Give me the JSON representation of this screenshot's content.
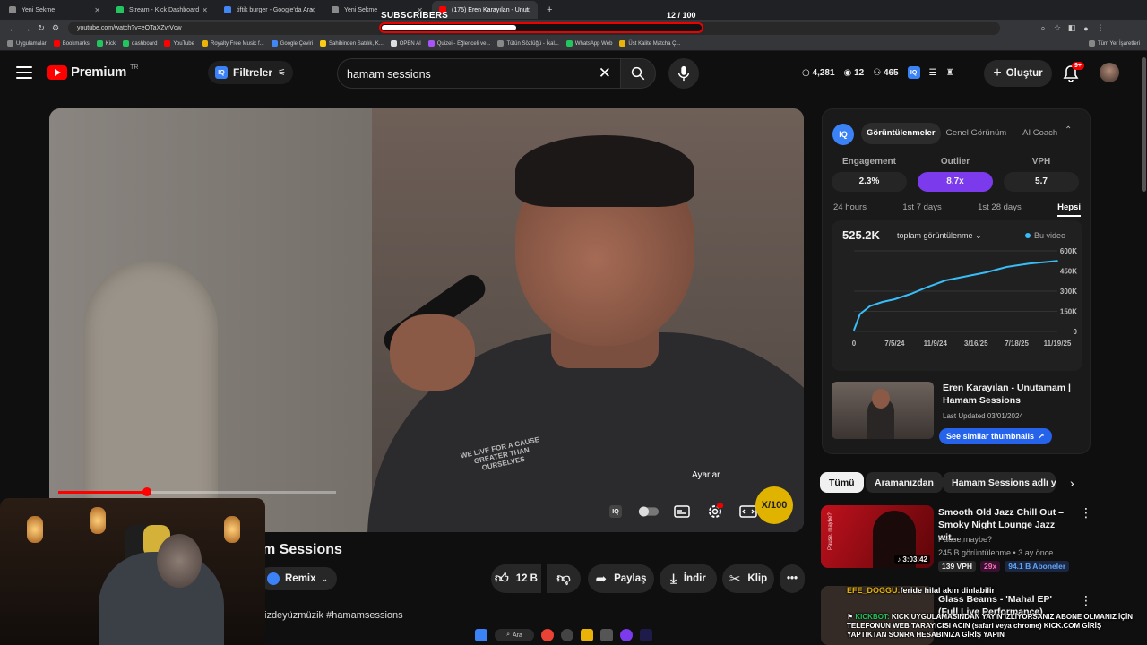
{
  "browser": {
    "tabs": [
      {
        "label": "Yeni Sekme",
        "color": "#8a8a8a"
      },
      {
        "label": "Stream - Kick Dashboard",
        "color": "#22c55e"
      },
      {
        "label": "tiftik burger - Google'da Ara",
        "color": "#4285f4"
      },
      {
        "label": "Yeni Sekme",
        "color": "#8a8a8a"
      },
      {
        "label": "(175) Eren Karayılan - Unut",
        "color": "#ff0000"
      }
    ],
    "url": "youtube.com/watch?v=eOTaXZvrVcw",
    "bookmarks": [
      "Uygulamalar",
      "Bookmarks",
      "Kick",
      "dashboard",
      "YouTube",
      "Royalty Free Music f...",
      "Google Çeviri",
      "Sahibinden Satılık, K...",
      "OPEN AI",
      "Quizei - Eğlenceli ve...",
      "Tütün Sözlüğü - İkal...",
      "WhatsApp Web",
      "Üst Kalite Matcha Ç..."
    ],
    "all_bookmarks": "Tüm Yer İşaretleri"
  },
  "subscribers": {
    "label": "SUBSCRIBERS",
    "count_text": "12  / 100",
    "current": 12,
    "goal": 100
  },
  "header": {
    "logo_text": "Premium",
    "logo_region": "TR",
    "filters_label": "Filtreler",
    "search_value": "hamam sessions",
    "stats": [
      "4,281",
      "12",
      "465"
    ],
    "create_label": "Oluştur",
    "notifications": "9+"
  },
  "video": {
    "progress_fraction": 0.32,
    "tooltip": "Ayarlar",
    "shirt_text": "WE LIVE FOR A CAUSE GREATER THAN OURSELVES",
    "badge_text": "X/100",
    "title_visible": "m Sessions",
    "remix_label": "Remix",
    "like_count": "12 B",
    "share_label": "Paylaş",
    "download_label": "İndir",
    "clip_label": "Klip",
    "description_line": "izdeyüzmüzik #hamamsessions"
  },
  "iq_panel": {
    "logo": "IQ",
    "tabs": [
      "Görüntülenmeler",
      "Genel Görünüm",
      "AI Coach"
    ],
    "active_tab": 0,
    "metrics": [
      {
        "label": "Engagement",
        "value": "2.3%"
      },
      {
        "label": "Outlier",
        "value": "8.7x"
      },
      {
        "label": "VPH",
        "value": "5.7"
      }
    ],
    "ranges": [
      "24 hours",
      "1st 7 days",
      "1st 28 days",
      "Hepsi"
    ],
    "active_range": 3,
    "total_views": "525.2K",
    "views_dropdown": "toplam görüntülenme",
    "legend": "Bu video",
    "related_title": "Eren Karayılan - Unutamam | Hamam Sessions",
    "related_updated": "Last Updated 03/01/2024",
    "similar_button": "See similar thumbnails"
  },
  "chart_data": {
    "type": "line",
    "x_tick_labels": [
      "0",
      "7/5/24",
      "11/9/24",
      "3/16/25",
      "7/18/25",
      "11/19/25"
    ],
    "y_tick_labels": [
      "0",
      "150K",
      "300K",
      "450K",
      "600K"
    ],
    "ylim": [
      0,
      600000
    ],
    "series": [
      {
        "name": "Bu video",
        "x": [
          0,
          0.03,
          0.08,
          0.14,
          0.2,
          0.28,
          0.36,
          0.45,
          0.55,
          0.65,
          0.75,
          0.86,
          1.0
        ],
        "values": [
          10000,
          130000,
          190000,
          220000,
          240000,
          280000,
          330000,
          380000,
          410000,
          440000,
          480000,
          505000,
          525200
        ]
      }
    ],
    "color": "#38bdf8",
    "grid": true
  },
  "chips": [
    "Tümü",
    "Aramanızdan",
    "Hamam Sessions adlı yü"
  ],
  "recommendations": [
    {
      "title": "Smooth Old Jazz Chill Out – Smoky Night Lounge Jazz wit...",
      "channel": "Pause,maybe?",
      "meta": "245 B görüntülenme • 3 ay önce",
      "duration": "3:03:42",
      "vph": "139 VPH",
      "multiplier": "29x",
      "subs": "94.1 B Aboneler",
      "thumb_text": "Pause, maybe?"
    },
    {
      "title": "Glass Beams - 'Mahal EP' (Full Live Performance)"
    }
  ],
  "chat": [
    {
      "user": "EFE_DOGGU:",
      "text": "feride hilal akın dinlabilir"
    },
    {
      "user": "KICKBOT:",
      "text": "KICK UYGULAMASINDAN YAYIN İZLİYORSANIZ ABONE OLMANIZ İÇİN TELEFONUN WEB TARAYICISI ACIN (safari veya chrome) KICK.COM GİRİŞ YAPTIKTAN SONRA HESABINIZA GİRİŞ YAPIN"
    }
  ],
  "taskbar": {
    "search_label": "Ara"
  }
}
